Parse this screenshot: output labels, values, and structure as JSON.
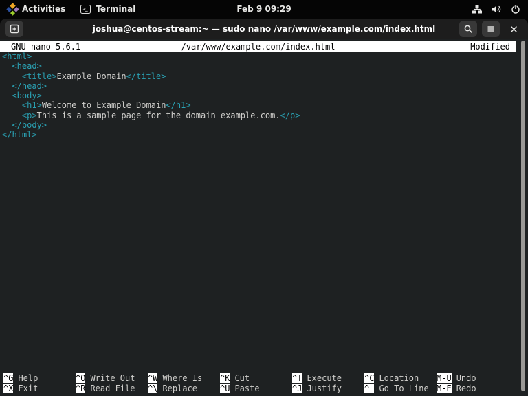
{
  "topbar": {
    "activities_label": "Activities",
    "app_label": "Terminal",
    "clock": "Feb 9 09:29"
  },
  "headerbar": {
    "title": "joshua@centos-stream:~ — sudo nano /var/www/example.com/index.html"
  },
  "nano": {
    "version_label": "GNU nano 5.6.1",
    "file_path": "/var/www/example.com/index.html",
    "status": "Modified",
    "shortcuts": {
      "rows": [
        [
          {
            "key": "^G",
            "label": "Help"
          },
          {
            "key": "^O",
            "label": "Write Out"
          },
          {
            "key": "^W",
            "label": "Where Is"
          },
          {
            "key": "^K",
            "label": "Cut"
          },
          {
            "key": "^T",
            "label": "Execute"
          },
          {
            "key": "^C",
            "label": "Location"
          },
          {
            "key": "M-U",
            "label": "Undo"
          }
        ],
        [
          {
            "key": "^X",
            "label": "Exit"
          },
          {
            "key": "^R",
            "label": "Read File"
          },
          {
            "key": "^\\",
            "label": "Replace"
          },
          {
            "key": "^U",
            "label": "Paste"
          },
          {
            "key": "^J",
            "label": "Justify"
          },
          {
            "key": "^_",
            "label": "Go To Line"
          },
          {
            "key": "M-E",
            "label": "Redo"
          }
        ]
      ]
    }
  },
  "editor": {
    "lines": [
      [
        {
          "type": "tag",
          "text": "<html>"
        }
      ],
      [
        {
          "type": "plain",
          "text": "  "
        },
        {
          "type": "tag",
          "text": "<head>"
        }
      ],
      [
        {
          "type": "plain",
          "text": "    "
        },
        {
          "type": "tag",
          "text": "<title>"
        },
        {
          "type": "plain",
          "text": "Example Domain"
        },
        {
          "type": "tag",
          "text": "</title>"
        }
      ],
      [
        {
          "type": "plain",
          "text": "  "
        },
        {
          "type": "tag",
          "text": "</head>"
        }
      ],
      [
        {
          "type": "plain",
          "text": "  "
        },
        {
          "type": "tag",
          "text": "<body>"
        }
      ],
      [
        {
          "type": "plain",
          "text": "    "
        },
        {
          "type": "tag",
          "text": "<h1>"
        },
        {
          "type": "plain",
          "text": "Welcome to Example Domain"
        },
        {
          "type": "tag",
          "text": "</h1>"
        }
      ],
      [
        {
          "type": "plain",
          "text": "    "
        },
        {
          "type": "tag",
          "text": "<p>"
        },
        {
          "type": "plain",
          "text": "This is a sample page for the domain example.com."
        },
        {
          "type": "tag",
          "text": "</p>"
        }
      ],
      [
        {
          "type": "plain",
          "text": "  "
        },
        {
          "type": "tag",
          "text": "</body>"
        }
      ],
      [
        {
          "type": "tag",
          "text": "</html>"
        }
      ]
    ]
  },
  "icons": {
    "centos-logo-icon": "four-color pinwheel",
    "terminal-icon": "prompt >_ in rounded square",
    "network-icon": "wired network nodes",
    "volume-icon": "speaker with waves",
    "power-icon": "power symbol",
    "new-tab-icon": "square with plus",
    "search-icon": "magnifier",
    "menu-icon": "hamburger lines",
    "close-icon": "x cross"
  },
  "colors": {
    "topbar_bg": "#050505",
    "headerbar_bg": "#1d1d1d",
    "terminal_bg": "#1e2122",
    "tag_accent": "#2aa1b3",
    "foreground": "#d0cfcc",
    "nano_bar_bg": "#ffffff",
    "scrollbar_thumb": "#9a9996"
  }
}
